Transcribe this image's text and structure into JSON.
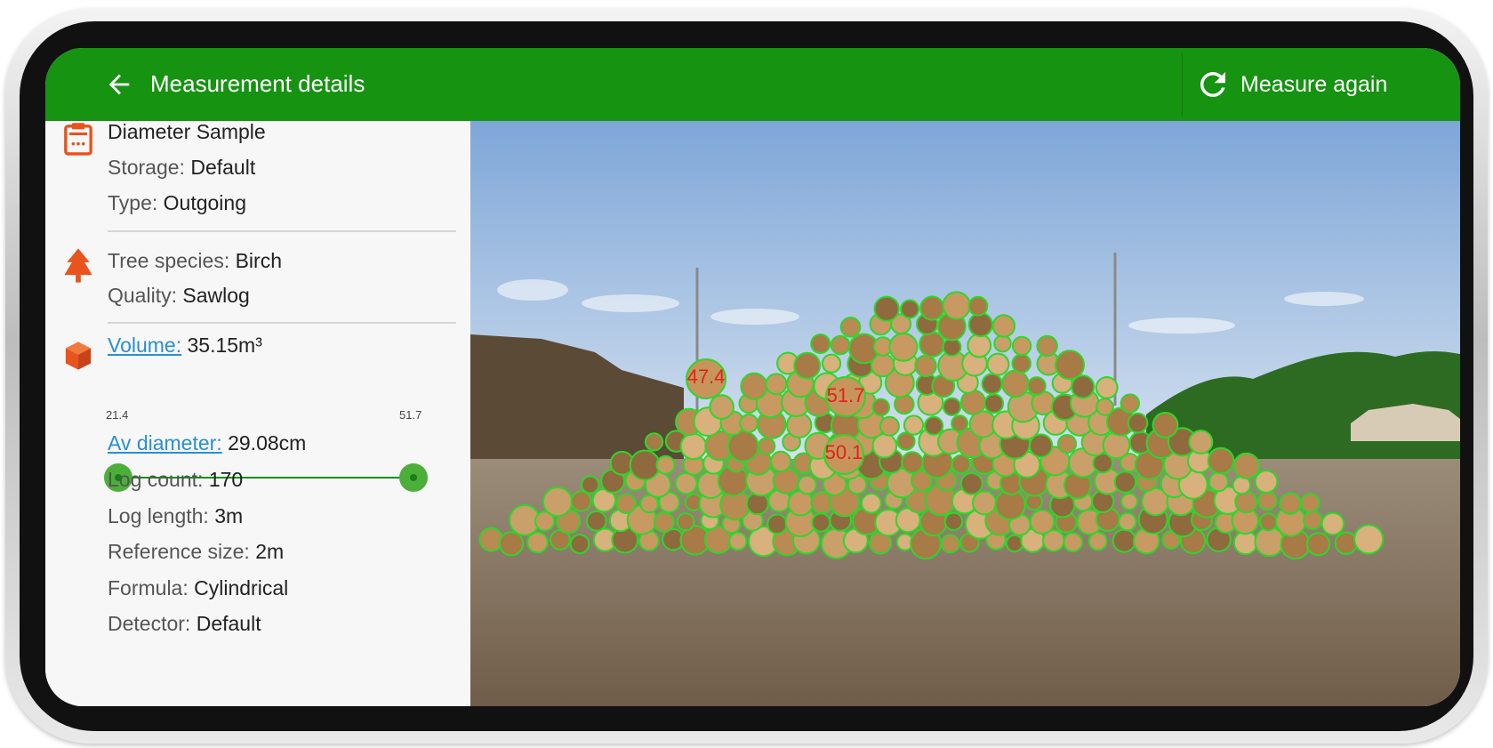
{
  "app_bar": {
    "title": "Measurement details",
    "measure_again_label": "Measure again",
    "color": "#169311"
  },
  "details": {
    "sample_name": "Diameter Sample",
    "storage": {
      "label": "Storage:",
      "value": "Default"
    },
    "type": {
      "label": "Type:",
      "value": "Outgoing"
    },
    "tree_species": {
      "label": "Tree species:",
      "value": "Birch"
    },
    "quality": {
      "label": "Quality:",
      "value": "Sawlog"
    },
    "volume": {
      "label": "Volume:",
      "value": "35.15m³"
    },
    "range": {
      "min": "21.4",
      "max": "51.7",
      "selected_min": 21.4,
      "selected_max": 51.7
    },
    "av_diameter": {
      "label": "Av diameter:",
      "value": "29.08cm"
    },
    "log_count": {
      "label": "Log count:",
      "value": "170"
    },
    "log_length": {
      "label": "Log length:",
      "value": "3m"
    },
    "reference_size": {
      "label": "Reference size:",
      "value": "2m"
    },
    "formula": {
      "label": "Formula:",
      "value": "Cylindrical"
    },
    "detector": {
      "label": "Detector:",
      "value": "Default"
    }
  },
  "photo": {
    "highlight_labels": [
      "47.4",
      "51.7",
      "50.1"
    ],
    "detection_color": "#2fd62a",
    "label_color": "#e0231c"
  },
  "icons": {
    "back": "arrow-left-icon",
    "refresh": "refresh-icon",
    "sample": "clipboard-icon",
    "species": "tree-icon",
    "volume": "cube-icon",
    "accent": "#e8531e"
  }
}
